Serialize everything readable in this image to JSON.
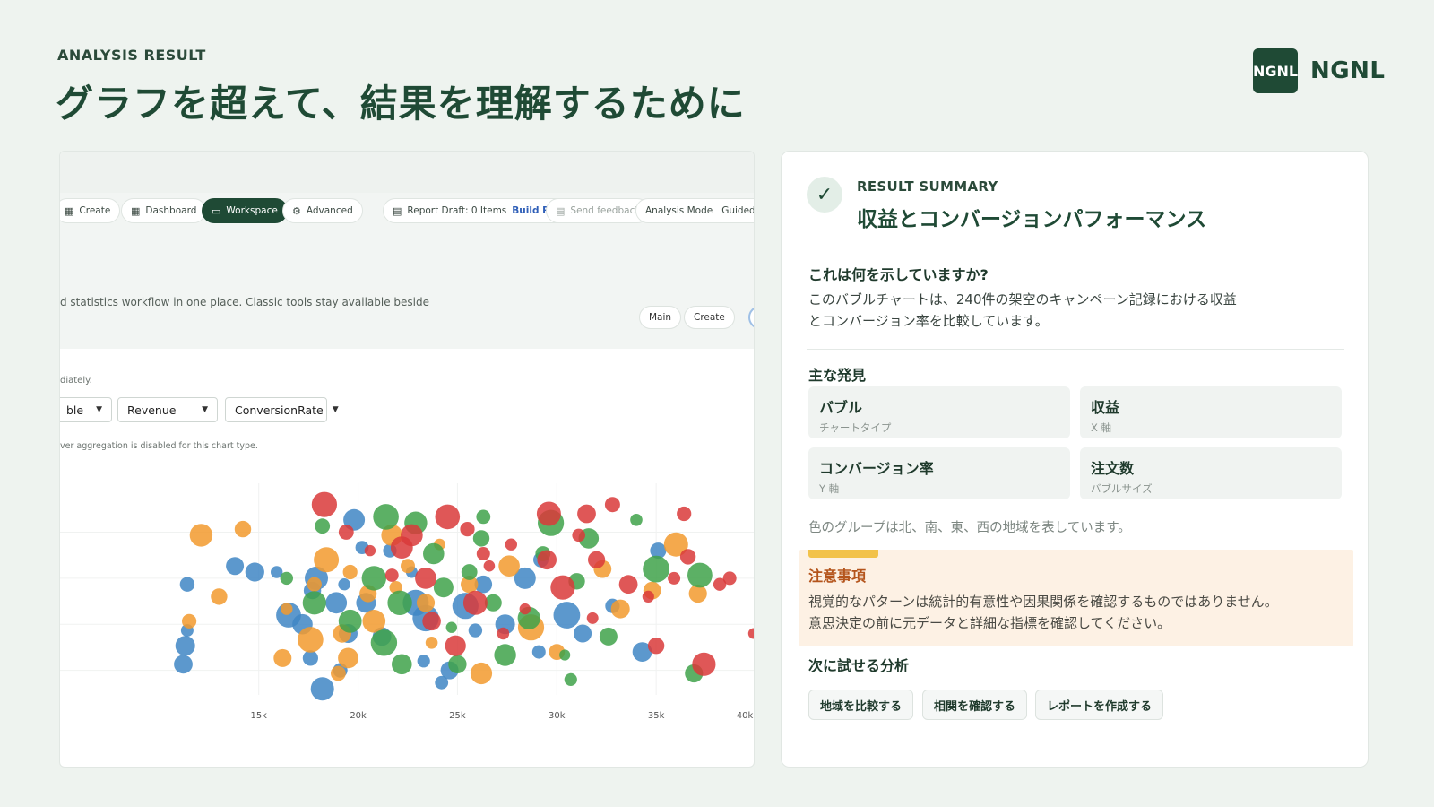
{
  "page": {
    "eyebrow": "ANALYSIS RESULT",
    "headline": "グラフを超えて、結果を理解するために",
    "brand_mark": "NGNL",
    "brand_name": "NGNL"
  },
  "app": {
    "toolbar": {
      "create": "Create",
      "dashboard": "Dashboard",
      "workspace": "Workspace",
      "advanced": "Advanced",
      "report_draft": "Report Draft: 0 Items",
      "build_report": "Build Report",
      "send_feedback": "Send feedback",
      "analysis_mode": "Analysis Mode",
      "guided": "Guided"
    },
    "intro_text": "d statistics workflow in one place. Classic tools stay available beside",
    "pills": {
      "main": "Main",
      "create": "Create"
    },
    "hint": "diately.",
    "selects": {
      "chart_type": "ble",
      "x_field": "Revenue",
      "y_field": "ConversionRate"
    },
    "note": "ver aggregation is disabled for this chart type."
  },
  "chart_data": {
    "type": "scatter",
    "subtype": "bubble",
    "x_ticks": [
      "15k",
      "20k",
      "25k",
      "30k",
      "35k",
      "40k"
    ],
    "x_range": [
      10000,
      40000
    ],
    "xlabel": "Revenue",
    "ylabel": "ConversionRate",
    "grid": true,
    "series": [
      {
        "color": "#3f86c4",
        "points": [
          [
            11200,
            0.32
          ],
          [
            11300,
            0.38
          ],
          [
            11400,
            0.43
          ],
          [
            11400,
            0.58
          ],
          [
            13800,
            0.64
          ],
          [
            14800,
            0.62
          ],
          [
            15900,
            0.62
          ],
          [
            16500,
            0.48
          ],
          [
            17200,
            0.45
          ],
          [
            17700,
            0.56
          ],
          [
            17600,
            0.34
          ],
          [
            17900,
            0.6
          ],
          [
            18900,
            0.52
          ],
          [
            19300,
            0.58
          ],
          [
            19500,
            0.42
          ],
          [
            19100,
            0.3
          ],
          [
            19800,
            0.79
          ],
          [
            20200,
            0.7
          ],
          [
            20400,
            0.52
          ],
          [
            21200,
            0.41
          ],
          [
            21600,
            0.69
          ],
          [
            22700,
            0.62
          ],
          [
            22900,
            0.52
          ],
          [
            23400,
            0.47
          ],
          [
            23300,
            0.33
          ],
          [
            24600,
            0.3
          ],
          [
            25400,
            0.51
          ],
          [
            25900,
            0.43
          ],
          [
            26300,
            0.58
          ],
          [
            27400,
            0.45
          ],
          [
            28400,
            0.6
          ],
          [
            29200,
            0.66
          ],
          [
            29100,
            0.36
          ],
          [
            30500,
            0.48
          ],
          [
            31300,
            0.42
          ],
          [
            32800,
            0.51
          ],
          [
            34300,
            0.36
          ],
          [
            35100,
            0.69
          ],
          [
            24200,
            0.26
          ],
          [
            18200,
            0.24
          ]
        ]
      },
      {
        "color": "#f29a2e",
        "points": [
          [
            13000,
            0.54
          ],
          [
            14200,
            0.76
          ],
          [
            16400,
            0.5
          ],
          [
            17600,
            0.4
          ],
          [
            17800,
            0.58
          ],
          [
            18400,
            0.66
          ],
          [
            19200,
            0.42
          ],
          [
            19600,
            0.62
          ],
          [
            19500,
            0.34
          ],
          [
            20500,
            0.55
          ],
          [
            20800,
            0.46
          ],
          [
            21700,
            0.74
          ],
          [
            21900,
            0.57
          ],
          [
            22500,
            0.64
          ],
          [
            23400,
            0.52
          ],
          [
            23700,
            0.39
          ],
          [
            24100,
            0.71
          ],
          [
            25600,
            0.58
          ],
          [
            26200,
            0.29
          ],
          [
            27600,
            0.64
          ],
          [
            28700,
            0.44
          ],
          [
            30000,
            0.36
          ],
          [
            32300,
            0.63
          ],
          [
            33200,
            0.5
          ],
          [
            34800,
            0.56
          ],
          [
            36000,
            0.71
          ],
          [
            37100,
            0.55
          ],
          [
            16200,
            0.34
          ],
          [
            19000,
            0.29
          ],
          [
            11500,
            0.46
          ],
          [
            12100,
            0.74
          ]
        ]
      },
      {
        "color": "#3fa24a",
        "points": [
          [
            16400,
            0.6
          ],
          [
            18200,
            0.77
          ],
          [
            19600,
            0.46
          ],
          [
            20800,
            0.6
          ],
          [
            21300,
            0.39
          ],
          [
            21400,
            0.8
          ],
          [
            22100,
            0.52
          ],
          [
            22900,
            0.78
          ],
          [
            23800,
            0.68
          ],
          [
            24300,
            0.57
          ],
          [
            24700,
            0.44
          ],
          [
            25600,
            0.62
          ],
          [
            26200,
            0.73
          ],
          [
            26300,
            0.8
          ],
          [
            26800,
            0.52
          ],
          [
            27400,
            0.35
          ],
          [
            28600,
            0.47
          ],
          [
            29300,
            0.68
          ],
          [
            29700,
            0.78
          ],
          [
            30400,
            0.35
          ],
          [
            31000,
            0.59
          ],
          [
            31600,
            0.73
          ],
          [
            32600,
            0.41
          ],
          [
            34000,
            0.79
          ],
          [
            35000,
            0.63
          ],
          [
            36900,
            0.29
          ],
          [
            37200,
            0.61
          ],
          [
            22200,
            0.32
          ],
          [
            25000,
            0.32
          ],
          [
            30700,
            0.27
          ],
          [
            17800,
            0.52
          ]
        ]
      },
      {
        "color": "#d93a3a",
        "points": [
          [
            18300,
            0.84
          ],
          [
            19400,
            0.75
          ],
          [
            20600,
            0.69
          ],
          [
            21700,
            0.61
          ],
          [
            22200,
            0.7
          ],
          [
            22700,
            0.74
          ],
          [
            23400,
            0.6
          ],
          [
            24500,
            0.8
          ],
          [
            25500,
            0.76
          ],
          [
            25900,
            0.52
          ],
          [
            26300,
            0.68
          ],
          [
            26600,
            0.64
          ],
          [
            27700,
            0.71
          ],
          [
            28400,
            0.5
          ],
          [
            29500,
            0.66
          ],
          [
            29600,
            0.81
          ],
          [
            30300,
            0.57
          ],
          [
            31100,
            0.74
          ],
          [
            31500,
            0.81
          ],
          [
            31800,
            0.47
          ],
          [
            32800,
            0.84
          ],
          [
            33600,
            0.58
          ],
          [
            34600,
            0.54
          ],
          [
            35000,
            0.38
          ],
          [
            36400,
            0.81
          ],
          [
            36600,
            0.67
          ],
          [
            37400,
            0.32
          ],
          [
            38200,
            0.58
          ],
          [
            38700,
            0.6
          ],
          [
            39900,
            0.42
          ],
          [
            24900,
            0.38
          ],
          [
            27300,
            0.42
          ],
          [
            32000,
            0.66
          ],
          [
            35900,
            0.6
          ],
          [
            23700,
            0.46
          ]
        ]
      }
    ]
  },
  "panel": {
    "eyebrow": "RESULT SUMMARY",
    "title": "収益とコンバージョンパフォーマンス",
    "q_title": "これは何を示していますか?",
    "q_line1": "このバブルチャートは、240件の架空のキャンペーン記録における収益",
    "q_line2": "とコンバージョン率を比較しています。",
    "findings_title": "主な発見",
    "findings": [
      {
        "value": "バブル",
        "label": "チャートタイプ"
      },
      {
        "value": "収益",
        "label": "X 軸"
      },
      {
        "value": "コンバージョン率",
        "label": "Y 軸"
      },
      {
        "value": "注文数",
        "label": "バブルサイズ"
      }
    ],
    "groups_note": "色のグループは北、南、東、西の地域を表しています。",
    "caution_title": "注意事項",
    "caution_line1": "視覚的なパターンは統計的有意性や因果関係を確認するものではありません。",
    "caution_line2": "意思決定の前に元データと詳細な指標を確認してください。",
    "next_title": "次に試せる分析",
    "actions": [
      "地域を比較する",
      "相関を確認する",
      "レポートを作成する"
    ]
  }
}
